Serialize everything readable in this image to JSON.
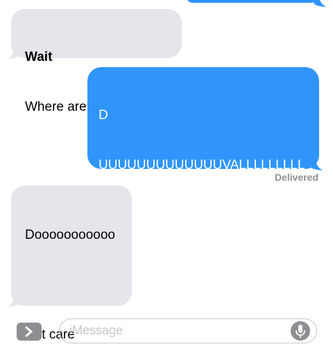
{
  "conversation": {
    "messages": [
      {
        "direction": "incoming",
        "sender": "Wait",
        "text": "Where are you from ?"
      },
      {
        "direction": "outgoing",
        "text": "D\n\n\nUUUUUUUUUUUUUVALLLLLLLLLLLL"
      },
      {
        "direction": "incoming",
        "text": "Dooooooooooo\n\n\n\n\n\nNot care"
      }
    ],
    "status": "Delivered"
  },
  "composer": {
    "placeholder": "iMessage"
  },
  "colors": {
    "incoming_bubble": "#e6e5eb",
    "outgoing_bubble": "#2f95fb",
    "status_text": "#8e8e93"
  }
}
